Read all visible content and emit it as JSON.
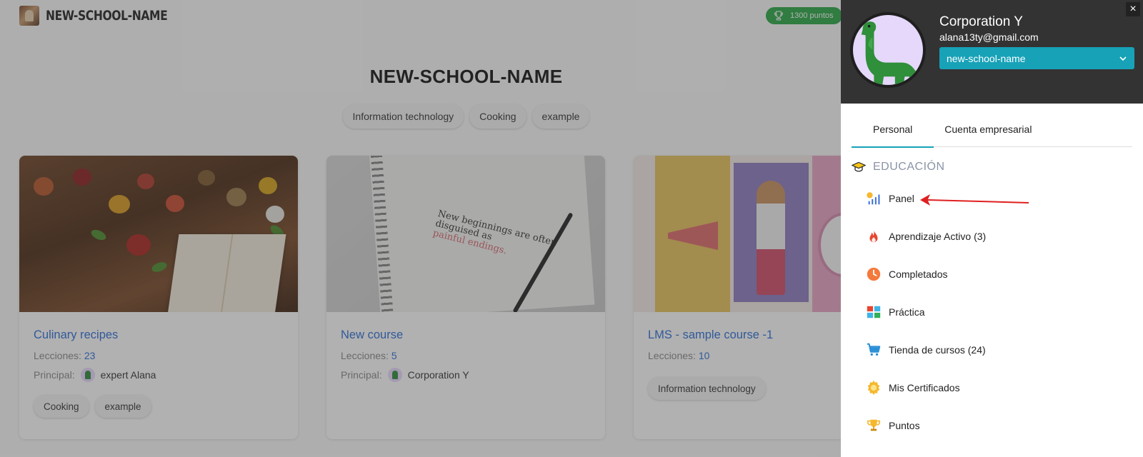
{
  "header": {
    "brand": "NEW-SCHOOL-NAME",
    "points": "1300 puntos"
  },
  "main": {
    "title": "NEW-SCHOOL-NAME",
    "chips": [
      "Information technology",
      "Cooking",
      "example"
    ],
    "cards": [
      {
        "title": "Culinary recipes",
        "lessons_label": "Lecciones:",
        "lessons": "23",
        "principal_label": "Principal:",
        "principal": "expert Alana",
        "tags": [
          "Cooking",
          "example"
        ]
      },
      {
        "title": "New course",
        "lessons_label": "Lecciones:",
        "lessons": "5",
        "principal_label": "Principal:",
        "principal": "Corporation Y",
        "image_quote_1": "New beginnings are often",
        "image_quote_2": "disguised as",
        "image_quote_3": "painful endings."
      },
      {
        "title": "LMS - sample course -1",
        "lessons_label": "Lecciones:",
        "lessons": "10",
        "tags": [
          "Information technology"
        ]
      }
    ]
  },
  "drawer": {
    "close": "×",
    "user_name": "Corporation Y",
    "user_email": "alana13ty@gmail.com",
    "school_select": "new-school-name",
    "tabs": [
      {
        "label": "Personal"
      },
      {
        "label": "Cuenta empresarial"
      }
    ],
    "section_title": "EDUCACIÓN",
    "menu": [
      {
        "label": "Panel",
        "icon": "chart-bars-icon"
      },
      {
        "label": "Aprendizaje Activo (3)",
        "icon": "fire-icon"
      },
      {
        "label": "Completados",
        "icon": "clock-icon"
      },
      {
        "label": "Práctica",
        "icon": "grid-icon"
      },
      {
        "label": "Tienda de cursos (24)",
        "icon": "cart-icon"
      },
      {
        "label": "Mis Certificados",
        "icon": "certificate-icon"
      },
      {
        "label": "Puntos",
        "icon": "trophy-icon"
      }
    ]
  },
  "colors": {
    "accent": "#17a2b8",
    "link": "#2a6dd8",
    "points_badge": "#28a745",
    "drawer_header": "#333333",
    "annotation_arrow": "#e02020"
  }
}
